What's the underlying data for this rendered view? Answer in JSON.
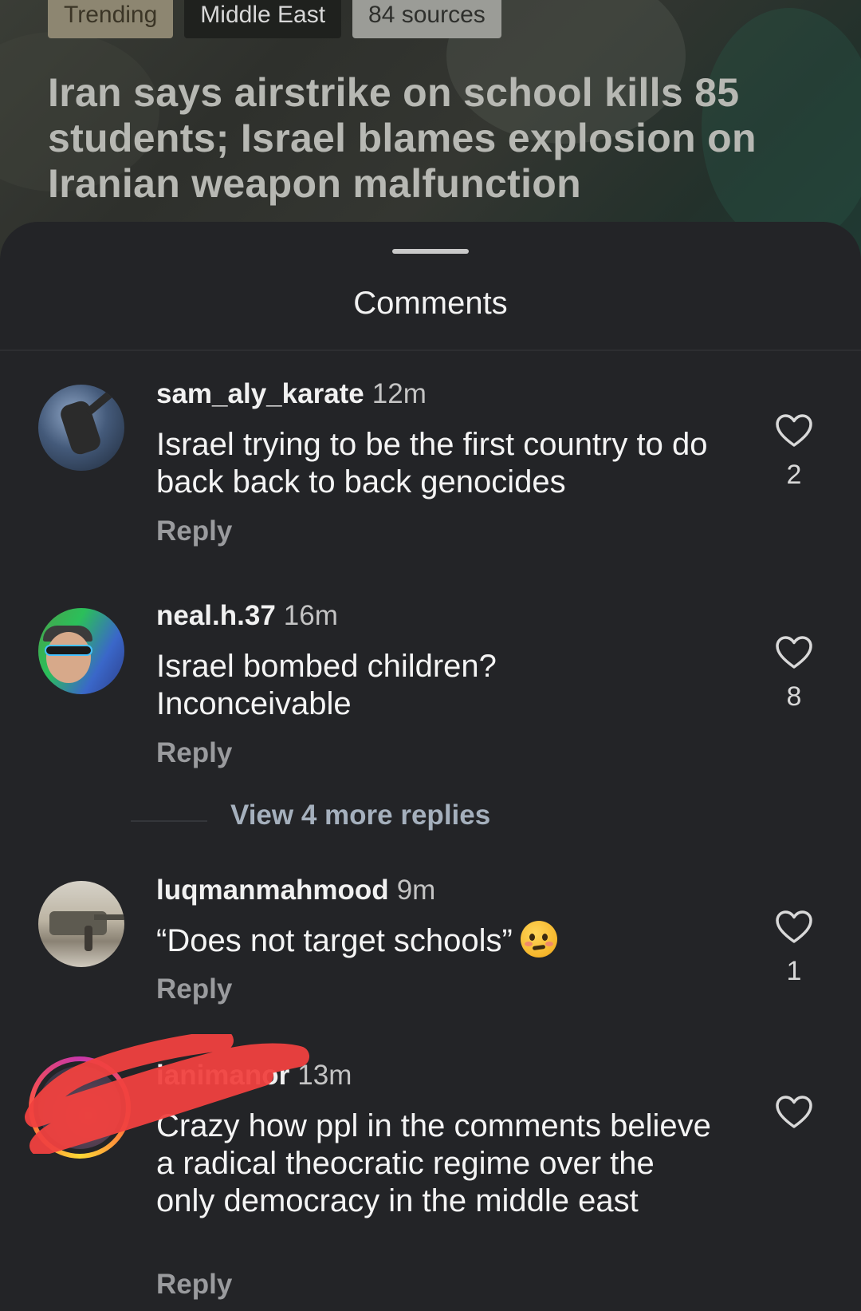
{
  "article": {
    "chips": [
      "Trending",
      "Middle East",
      "84 sources"
    ],
    "headline": "Iran says airstrike on school kills 85 students; Israel blames explosion on Iranian weapon malfunction"
  },
  "sheet": {
    "title": "Comments"
  },
  "comments": [
    {
      "username": "sam_aly_karate",
      "time": "12m",
      "text": "Israel trying to be the first country to do back back to back genocides",
      "reply": "Reply",
      "likes": "2"
    },
    {
      "username": "neal.h.37",
      "time": "16m",
      "text": "Israel bombed children? Inconceivable",
      "reply": "Reply",
      "likes": "8",
      "view_more": "View 4 more replies"
    },
    {
      "username": "luqmanmahmood",
      "time": "9m",
      "text": "“Does not target schools”",
      "emoji": "woozy-face-emoji",
      "reply": "Reply",
      "likes": "1"
    },
    {
      "username": "ianimanor",
      "time": "13m",
      "text": "Crazy how ppl in the comments believe a radical theocratic regime over the only democracy in the middle east",
      "reply": "Reply",
      "likes": ""
    }
  ],
  "icons": {
    "like": "heart-outline-icon",
    "redaction": "red-scribble-redaction"
  },
  "colors": {
    "sheet_bg": "#232427",
    "accent_chip": "#8d8671",
    "redaction": "#f0413f"
  }
}
